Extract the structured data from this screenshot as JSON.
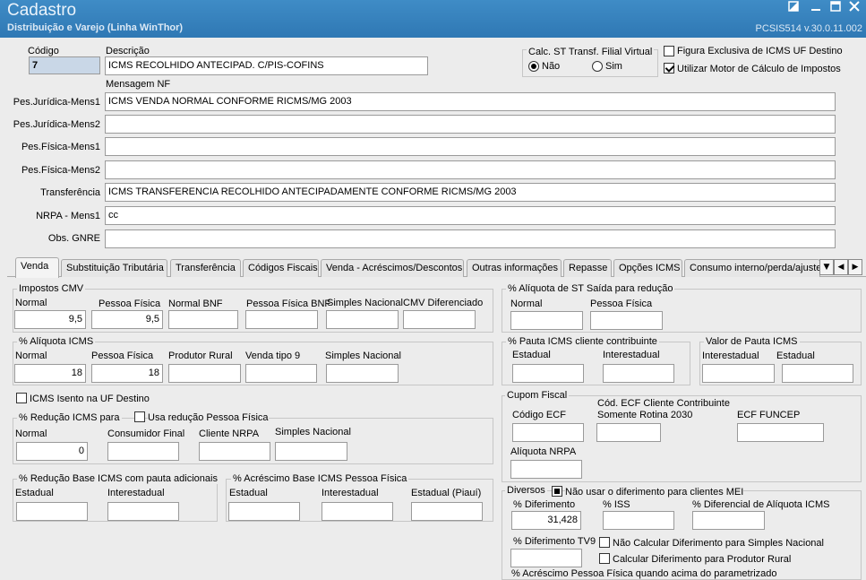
{
  "window": {
    "title": "Cadastro",
    "subtitle": "Distribuição e Varejo (Linha WinThor)",
    "version": "PCSIS514  v.30.0.11.002"
  },
  "header": {
    "codigo_label": "Código",
    "codigo_value": "7",
    "descricao_label": "Descrição",
    "descricao_value": "ICMS RECOLHIDO ANTECIPAD. C/PIS-COFINS",
    "calc_st_label": "Calc. ST Transf. Filial Virtual",
    "nao_label": "Não",
    "sim_label": "Sim",
    "figura_label": "Figura Exclusiva de ICMS UF Destino",
    "motor_label": "Utilizar Motor de Cálculo de Impostos",
    "mensagem_label": "Mensagem NF"
  },
  "messages": [
    {
      "label": "Pes.Jurídica-Mens1",
      "value": "ICMS  VENDA NORMAL  CONFORME RICMS/MG 2003"
    },
    {
      "label": "Pes.Jurídica-Mens2",
      "value": ""
    },
    {
      "label": "Pes.Física-Mens1",
      "value": ""
    },
    {
      "label": "Pes.Física-Mens2",
      "value": ""
    },
    {
      "label": "Transferência",
      "value": "ICMS  TRANSFERENCIA  RECOLHIDO ANTECIPADAMENTE CONFORME RICMS/MG 2003"
    },
    {
      "label": "NRPA - Mens1",
      "value": "cc"
    },
    {
      "label": "Obs. GNRE",
      "value": ""
    }
  ],
  "tabs": [
    "Venda",
    "Substituição Tributária",
    "Transferência",
    "Códigos Fiscais",
    "Venda - Acréscimos/Descontos",
    "Outras informações",
    "Repasse",
    "Opções ICMS",
    "Consumo interno/perda/ajuste"
  ],
  "venda": {
    "impostos_cmv": {
      "title": "Impostos CMV",
      "normal_label": "Normal",
      "normal_value": "9,5",
      "pf_label": "Pessoa Física",
      "pf_value": "9,5",
      "normal_bnf_label": "Normal BNF",
      "pf_bnf_label": "Pessoa Física BNF",
      "simples_label": "Simples Nacional",
      "cmv_dif_label": "CMV Diferenciado"
    },
    "aliq_icms": {
      "title": "% Alíquota ICMS",
      "normal_label": "Normal",
      "normal_value": "18",
      "pf_label": "Pessoa Física",
      "pf_value": "18",
      "produtor_label": "Produtor Rural",
      "venda9_label": "Venda tipo 9",
      "simples_label": "Simples Nacional"
    },
    "icms_isento_label": "ICMS Isento na UF Destino",
    "reducao_icms": {
      "title": "% Redução ICMS para",
      "usa_pf_label": "Usa redução Pessoa Física",
      "normal_label": "Normal",
      "normal_value": "0",
      "consumidor_label": "Consumidor Final",
      "nrpa_label": "Cliente NRPA",
      "simples_label": "Simples Nacional"
    },
    "reducao_base": {
      "title": "% Redução Base ICMS com pauta adicionais",
      "estadual_label": "Estadual",
      "interestadual_label": "Interestadual"
    },
    "acrescimo_base": {
      "title": "% Acréscimo Base ICMS Pessoa Física",
      "estadual_label": "Estadual",
      "interestadual_label": "Interestadual",
      "piaui_label": "Estadual (Piauí)"
    },
    "aliq_st_saida": {
      "title": "% Alíquota de ST Saída para redução",
      "normal_label": "Normal",
      "pf_label": "Pessoa Física"
    },
    "pauta_contrib": {
      "title": "% Pauta ICMS cliente contribuinte",
      "estadual_label": "Estadual",
      "interestadual_label": "Interestadual"
    },
    "valor_pauta": {
      "title": "Valor de Pauta ICMS",
      "interestadual_label": "Interestadual",
      "estadual_label": "Estadual"
    },
    "cupom_fiscal": {
      "title": "Cupom Fiscal",
      "codigo_ecf_label": "Código ECF",
      "cod_ecf_cliente_label1": "Cód. ECF Cliente Contribuinte",
      "cod_ecf_cliente_label2": "Somente Rotina 2030",
      "ecf_funcep_label": "ECF FUNCEP",
      "aliq_nrpa_label": "Alíquota NRPA"
    },
    "diversos": {
      "title": "Diversos",
      "nao_diferimento_label": "Não usar o diferimento para clientes MEI",
      "diferimento_label": "% Diferimento",
      "diferimento_value": "31,428",
      "iss_label": "% ISS",
      "dif_aliq_label": "% Diferencial de Alíquota ICMS",
      "dif_tv9_label": "% Diferimento TV9",
      "nao_calc_simples_label": "Não Calcular Diferimento para Simples Nacional",
      "calc_produtor_label": "Calcular Diferimento para Produtor Rural",
      "acrescimo_pf_label": "% Acréscimo Pessoa Física quando acima do parametrizado"
    }
  }
}
